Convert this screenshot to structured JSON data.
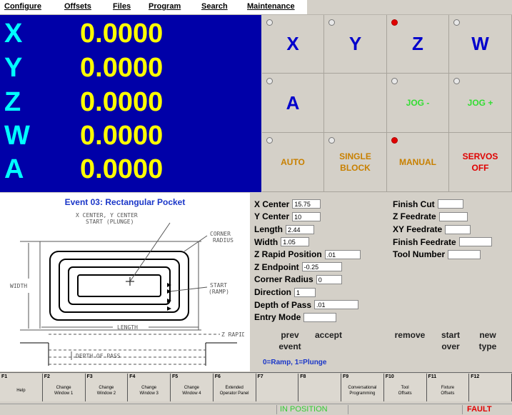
{
  "menu": [
    "Configure",
    "Offsets",
    "Files",
    "Program",
    "Search",
    "Maintenance"
  ],
  "dro": [
    {
      "axis": "X",
      "value": "0.0000"
    },
    {
      "axis": "Y",
      "value": "0.0000"
    },
    {
      "axis": "Z",
      "value": "0.0000"
    },
    {
      "axis": "W",
      "value": "0.0000"
    },
    {
      "axis": "A",
      "value": "0.0000"
    }
  ],
  "grid_buttons": [
    {
      "label": "X",
      "led": "off",
      "style": "big"
    },
    {
      "label": "Y",
      "led": "off",
      "style": "big"
    },
    {
      "label": "Z",
      "led": "on",
      "style": "big"
    },
    {
      "label": "W",
      "led": "off",
      "style": "big"
    },
    {
      "label": "A",
      "led": "off",
      "style": "big"
    },
    {
      "label": "",
      "led": "none",
      "style": "blank"
    },
    {
      "label": "JOG -",
      "led": "off",
      "style": "green"
    },
    {
      "label": "JOG +",
      "led": "off",
      "style": "green"
    },
    {
      "label": "AUTO",
      "led": "off",
      "style": "orange"
    },
    {
      "label": "SINGLE\nBLOCK",
      "led": "off",
      "style": "orange"
    },
    {
      "label": "MANUAL",
      "led": "on",
      "style": "orange"
    },
    {
      "label": "SERVOS\nOFF",
      "led": "none",
      "style": "red"
    }
  ],
  "event": {
    "title": "Event 03: Rectangular Pocket",
    "diagram_labels": {
      "center": "X CENTER, Y CENTER",
      "start_plunge": "START (PLUNGE)",
      "corner_radius_1": "CORNER",
      "corner_radius_2": "RADIUS",
      "width": "WIDTH",
      "start_ramp_1": "START",
      "start_ramp_2": "(RAMP)",
      "length": "LENGTH",
      "z_rapid": "Z RAPID",
      "depth_of_pass": "DEPTH OF PASS"
    }
  },
  "params_left": [
    {
      "label": "X Center",
      "value": "15.75"
    },
    {
      "label": "Y Center",
      "value": "10"
    },
    {
      "label": "Length",
      "value": "2.44"
    },
    {
      "label": "Width",
      "value": "1.05"
    },
    {
      "label": "Z Rapid Position",
      "value": ".01"
    },
    {
      "label": "Z Endpoint",
      "value": "-0.25"
    },
    {
      "label": "Corner Radius",
      "value": "0"
    },
    {
      "label": "Direction",
      "value": "1"
    },
    {
      "label": "Depth of Pass",
      "value": ".01"
    },
    {
      "label": "Entry Mode",
      "value": ""
    }
  ],
  "params_right": [
    {
      "label": "Finish Cut",
      "value": ""
    },
    {
      "label": "Z Feedrate",
      "value": ""
    },
    {
      "label": "XY Feedrate",
      "value": ""
    },
    {
      "label": "Finish Feedrate",
      "value": ""
    },
    {
      "label": "Tool Number",
      "value": ""
    }
  ],
  "actions": {
    "prev_event": "prev\nevent",
    "accept": "accept",
    "remove": "remove",
    "start_over": "start\nover",
    "new_type": "new\ntype"
  },
  "entry_hint": "0=Ramp, 1=Plunge",
  "fkeys": [
    {
      "key": "F1",
      "label": "Help"
    },
    {
      "key": "F2",
      "label": "Change\nWindow 1"
    },
    {
      "key": "F3",
      "label": "Change\nWindow 2"
    },
    {
      "key": "F4",
      "label": "Change\nWindow 3"
    },
    {
      "key": "F5",
      "label": "Change\nWindow 4"
    },
    {
      "key": "F6",
      "label": "Extended\nOperator Panel"
    },
    {
      "key": "F7",
      "label": ""
    },
    {
      "key": "F8",
      "label": ""
    },
    {
      "key": "F9",
      "label": "Conversational\nProgramming"
    },
    {
      "key": "F10",
      "label": "Tool\nOffsets"
    },
    {
      "key": "F11",
      "label": "Fixture\nOffsets"
    },
    {
      "key": "F12",
      "label": ""
    }
  ],
  "status": {
    "in_position": "IN POSITION",
    "fault": "FAULT"
  },
  "colors": {
    "dro_bg": "#0000a8",
    "axis_letter": "#00ffff",
    "axis_value": "#ffff00",
    "in_position": "#33cc33",
    "fault": "#e00000",
    "title_blue": "#1a36c8"
  }
}
